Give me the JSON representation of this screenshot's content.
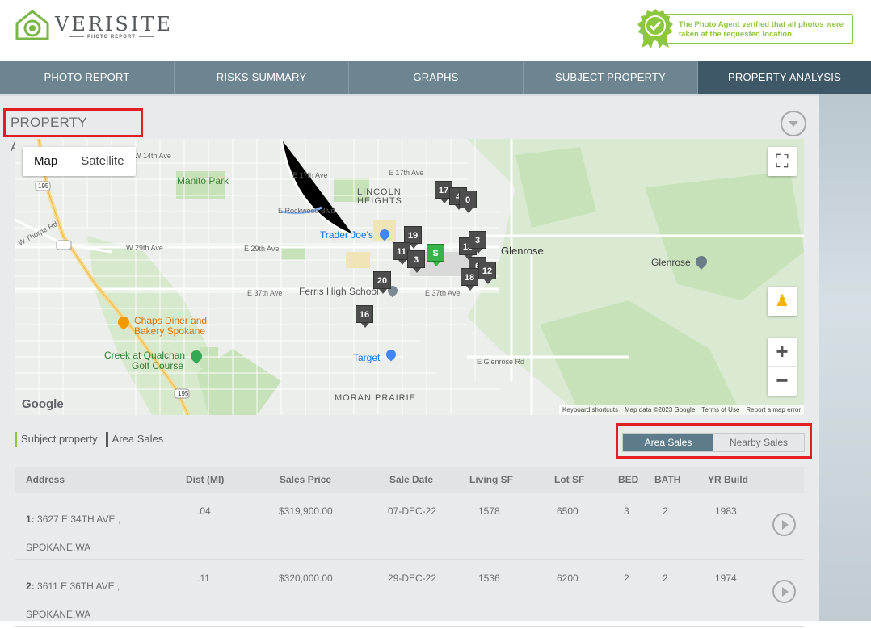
{
  "brand": {
    "title": "VERISITE",
    "subtitle": "PHOTO REPORT"
  },
  "verified_text": "The Photo Agent verified that all photos were taken at the requested location.",
  "tabs": [
    {
      "label": "PHOTO REPORT"
    },
    {
      "label": "RISKS SUMMARY"
    },
    {
      "label": "GRAPHS"
    },
    {
      "label": "SUBJECT PROPERTY"
    },
    {
      "label": "PROPERTY ANALYSIS"
    }
  ],
  "section_title": "PROPERTY ANALYSIS",
  "map": {
    "type_buttons": [
      "Map",
      "Satellite"
    ],
    "labels": {
      "manito": "Manito Park",
      "lincoln": "LINCOLN",
      "heights": "HEIGHTS",
      "traderjoes": "Trader Joe's",
      "glenrose1": "Glenrose",
      "glenrose2": "Glenrose",
      "ferris": "Ferris High School",
      "chaps1": "Chaps Diner and",
      "chaps2": "Bakery Spokane",
      "creek1": "Creek at Qualchan",
      "creek2": "Golf Course",
      "target": "Target",
      "moran": "MORAN PRAIRIE",
      "e14": "W 14th Ave",
      "e17": "E 17th Ave",
      "e17b": "E 17th Ave",
      "rockwood": "E Rockwood Blvd",
      "w29": "W 29th Ave",
      "e29": "E 29th Ave",
      "e37": "E 37th Ave",
      "e37b": "E 37th Ave",
      "glenroserd": "E Glenrose Rd",
      "thorpe": "W Thorpe Rd",
      "i195": "195",
      "hw195": "195"
    },
    "markers": [
      "17",
      "4",
      "0",
      "19",
      "13",
      "3",
      "11",
      "3",
      "S",
      "6",
      "12",
      "18",
      "20",
      "16"
    ],
    "google": "Google",
    "attribution": [
      "Keyboard shortcuts",
      "Map data ©2023 Google",
      "Terms of Use",
      "Report a map error"
    ]
  },
  "legend": {
    "subject": "Subject property",
    "area": "Area Sales"
  },
  "toggle": {
    "area": "Area Sales",
    "nearby": "Nearby Sales"
  },
  "table": {
    "headers": [
      "Address",
      "Dist (MI)",
      "Sales Price",
      "Sale Date",
      "Living SF",
      "Lot SF",
      "BED",
      "BATH",
      "YR Build"
    ],
    "rows": [
      {
        "num": "1:",
        "street": "3627 E 34TH AVE ,",
        "city": "SPOKANE,WA",
        "dist": ".04",
        "price": "$319,900.00",
        "date": "07-DEC-22",
        "living": "1578",
        "lot": "6500",
        "bed": "3",
        "bath": "2",
        "year": "1983"
      },
      {
        "num": "2:",
        "street": "3611 E 36TH AVE ,",
        "city": "SPOKANE,WA",
        "dist": ".11",
        "price": "$320,000.00",
        "date": "29-DEC-22",
        "living": "1536",
        "lot": "6200",
        "bed": "2",
        "bath": "2",
        "year": "1974"
      }
    ]
  },
  "colors": {
    "accent_green": "#8dc63f",
    "tab_bg": "#6d8590",
    "tab_active": "#3f5868",
    "highlight_red": "#e31c25",
    "toggle_on": "#5c7c8c"
  }
}
